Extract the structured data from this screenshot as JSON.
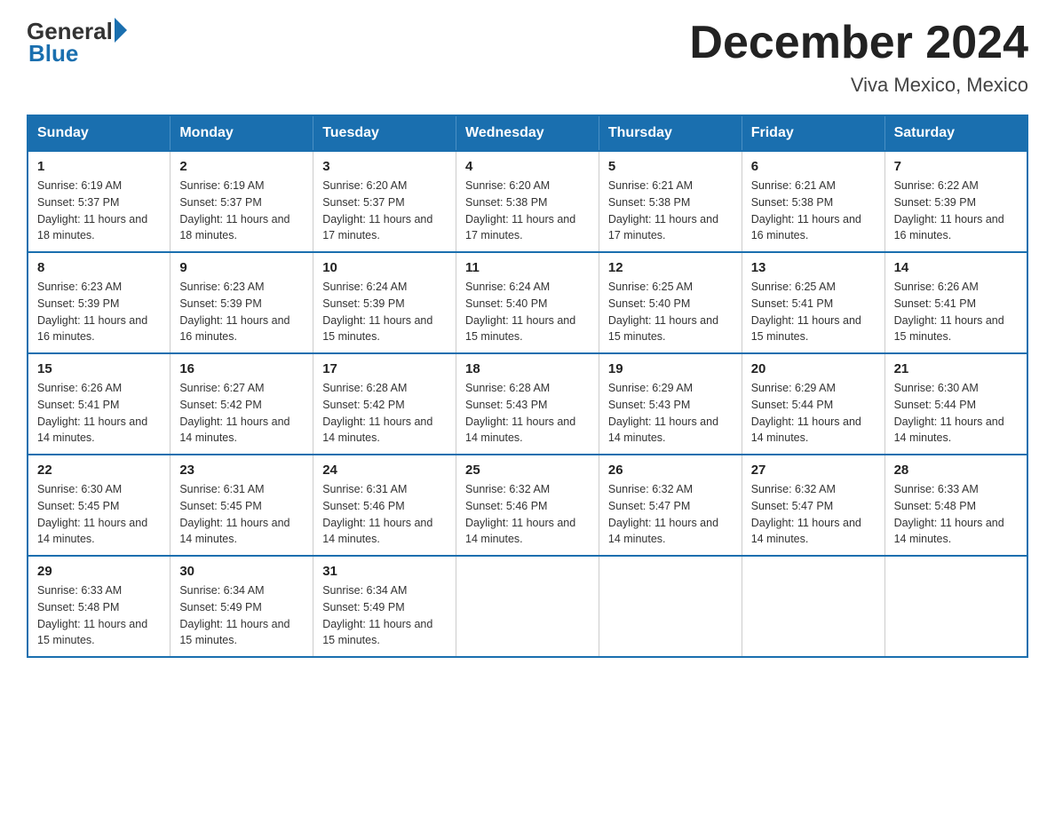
{
  "header": {
    "logo_general": "General",
    "logo_blue": "Blue",
    "month_title": "December 2024",
    "subtitle": "Viva Mexico, Mexico"
  },
  "weekdays": [
    "Sunday",
    "Monday",
    "Tuesday",
    "Wednesday",
    "Thursday",
    "Friday",
    "Saturday"
  ],
  "weeks": [
    [
      {
        "num": "1",
        "sunrise": "6:19 AM",
        "sunset": "5:37 PM",
        "daylight": "11 hours and 18 minutes."
      },
      {
        "num": "2",
        "sunrise": "6:19 AM",
        "sunset": "5:37 PM",
        "daylight": "11 hours and 18 minutes."
      },
      {
        "num": "3",
        "sunrise": "6:20 AM",
        "sunset": "5:37 PM",
        "daylight": "11 hours and 17 minutes."
      },
      {
        "num": "4",
        "sunrise": "6:20 AM",
        "sunset": "5:38 PM",
        "daylight": "11 hours and 17 minutes."
      },
      {
        "num": "5",
        "sunrise": "6:21 AM",
        "sunset": "5:38 PM",
        "daylight": "11 hours and 17 minutes."
      },
      {
        "num": "6",
        "sunrise": "6:21 AM",
        "sunset": "5:38 PM",
        "daylight": "11 hours and 16 minutes."
      },
      {
        "num": "7",
        "sunrise": "6:22 AM",
        "sunset": "5:39 PM",
        "daylight": "11 hours and 16 minutes."
      }
    ],
    [
      {
        "num": "8",
        "sunrise": "6:23 AM",
        "sunset": "5:39 PM",
        "daylight": "11 hours and 16 minutes."
      },
      {
        "num": "9",
        "sunrise": "6:23 AM",
        "sunset": "5:39 PM",
        "daylight": "11 hours and 16 minutes."
      },
      {
        "num": "10",
        "sunrise": "6:24 AM",
        "sunset": "5:39 PM",
        "daylight": "11 hours and 15 minutes."
      },
      {
        "num": "11",
        "sunrise": "6:24 AM",
        "sunset": "5:40 PM",
        "daylight": "11 hours and 15 minutes."
      },
      {
        "num": "12",
        "sunrise": "6:25 AM",
        "sunset": "5:40 PM",
        "daylight": "11 hours and 15 minutes."
      },
      {
        "num": "13",
        "sunrise": "6:25 AM",
        "sunset": "5:41 PM",
        "daylight": "11 hours and 15 minutes."
      },
      {
        "num": "14",
        "sunrise": "6:26 AM",
        "sunset": "5:41 PM",
        "daylight": "11 hours and 15 minutes."
      }
    ],
    [
      {
        "num": "15",
        "sunrise": "6:26 AM",
        "sunset": "5:41 PM",
        "daylight": "11 hours and 14 minutes."
      },
      {
        "num": "16",
        "sunrise": "6:27 AM",
        "sunset": "5:42 PM",
        "daylight": "11 hours and 14 minutes."
      },
      {
        "num": "17",
        "sunrise": "6:28 AM",
        "sunset": "5:42 PM",
        "daylight": "11 hours and 14 minutes."
      },
      {
        "num": "18",
        "sunrise": "6:28 AM",
        "sunset": "5:43 PM",
        "daylight": "11 hours and 14 minutes."
      },
      {
        "num": "19",
        "sunrise": "6:29 AM",
        "sunset": "5:43 PM",
        "daylight": "11 hours and 14 minutes."
      },
      {
        "num": "20",
        "sunrise": "6:29 AM",
        "sunset": "5:44 PM",
        "daylight": "11 hours and 14 minutes."
      },
      {
        "num": "21",
        "sunrise": "6:30 AM",
        "sunset": "5:44 PM",
        "daylight": "11 hours and 14 minutes."
      }
    ],
    [
      {
        "num": "22",
        "sunrise": "6:30 AM",
        "sunset": "5:45 PM",
        "daylight": "11 hours and 14 minutes."
      },
      {
        "num": "23",
        "sunrise": "6:31 AM",
        "sunset": "5:45 PM",
        "daylight": "11 hours and 14 minutes."
      },
      {
        "num": "24",
        "sunrise": "6:31 AM",
        "sunset": "5:46 PM",
        "daylight": "11 hours and 14 minutes."
      },
      {
        "num": "25",
        "sunrise": "6:32 AM",
        "sunset": "5:46 PM",
        "daylight": "11 hours and 14 minutes."
      },
      {
        "num": "26",
        "sunrise": "6:32 AM",
        "sunset": "5:47 PM",
        "daylight": "11 hours and 14 minutes."
      },
      {
        "num": "27",
        "sunrise": "6:32 AM",
        "sunset": "5:47 PM",
        "daylight": "11 hours and 14 minutes."
      },
      {
        "num": "28",
        "sunrise": "6:33 AM",
        "sunset": "5:48 PM",
        "daylight": "11 hours and 14 minutes."
      }
    ],
    [
      {
        "num": "29",
        "sunrise": "6:33 AM",
        "sunset": "5:48 PM",
        "daylight": "11 hours and 15 minutes."
      },
      {
        "num": "30",
        "sunrise": "6:34 AM",
        "sunset": "5:49 PM",
        "daylight": "11 hours and 15 minutes."
      },
      {
        "num": "31",
        "sunrise": "6:34 AM",
        "sunset": "5:49 PM",
        "daylight": "11 hours and 15 minutes."
      },
      null,
      null,
      null,
      null
    ]
  ]
}
